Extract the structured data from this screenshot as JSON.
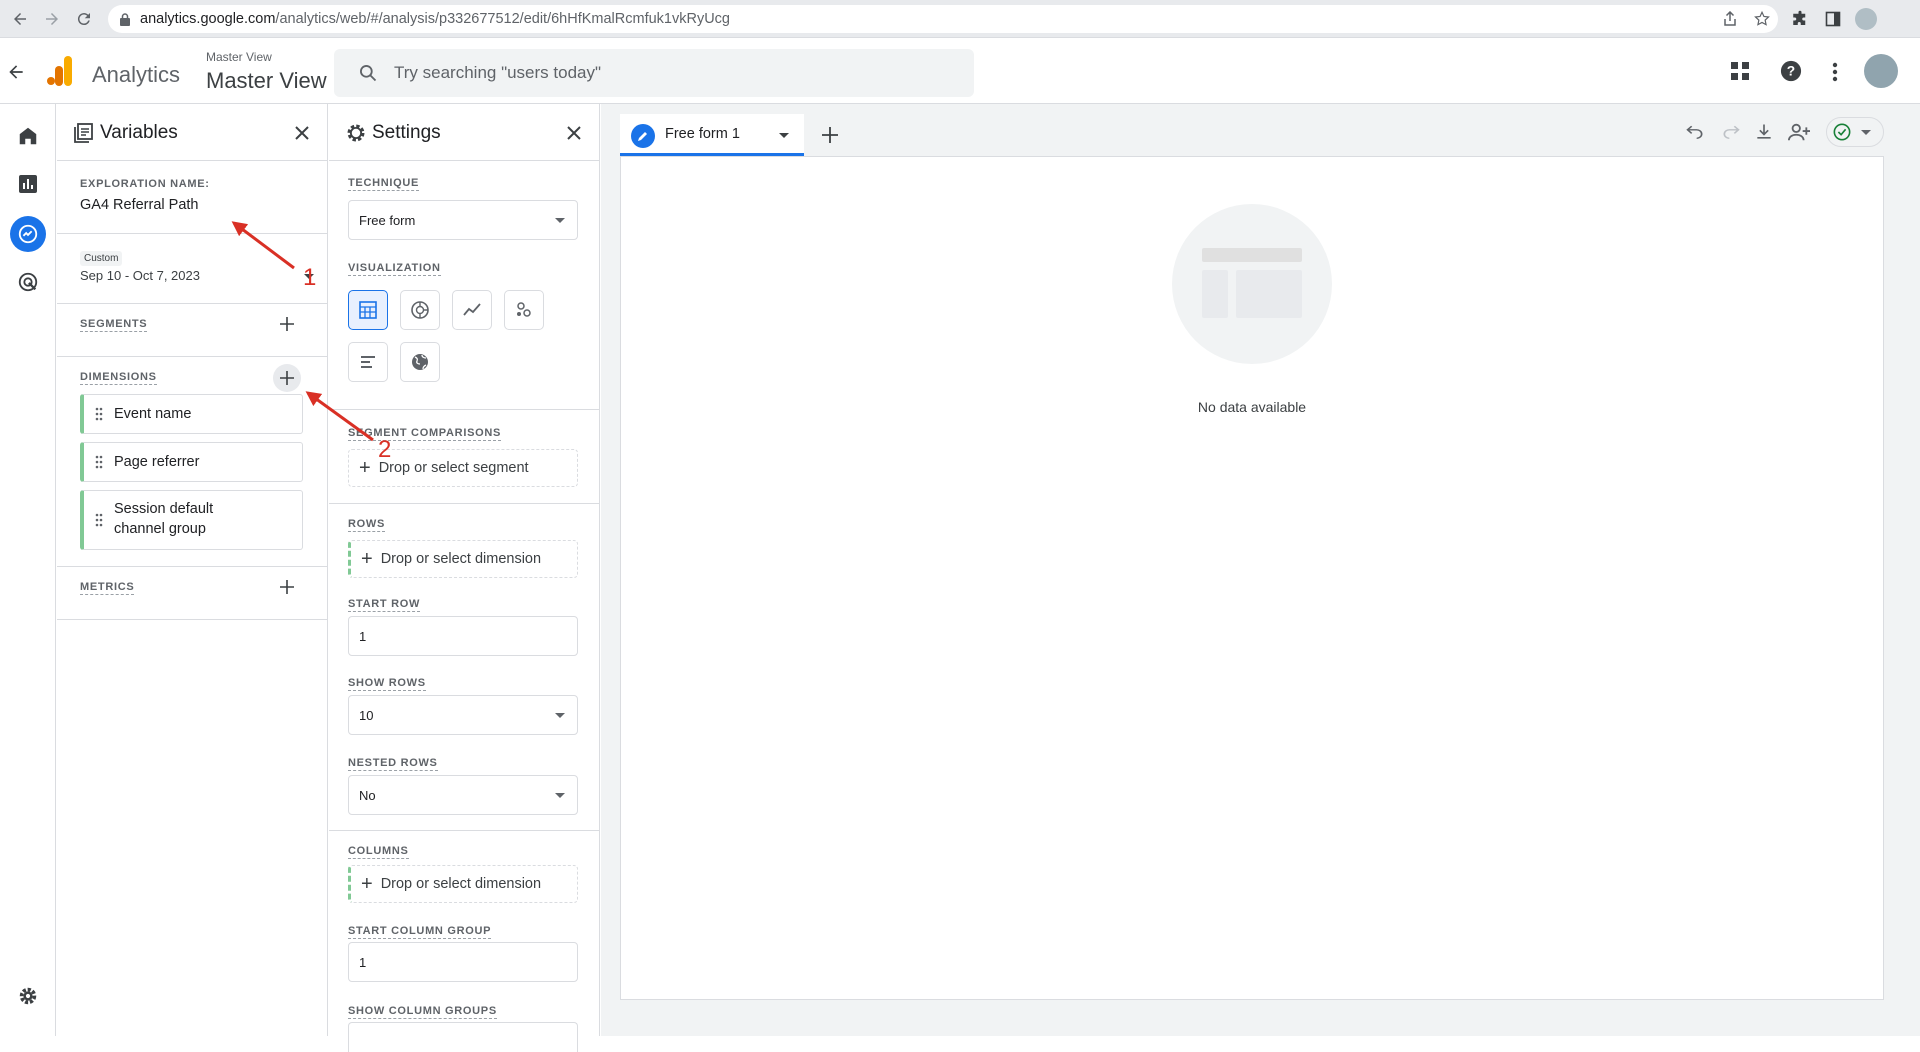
{
  "browser": {
    "url_domain": "analytics.google.com",
    "url_path": "/analytics/web/#/analysis/p332677512/edit/6hHfKmalRcmfuk1vkRyUcg"
  },
  "header": {
    "app_name": "Analytics",
    "account_label": "Master View",
    "property_name": "Master View",
    "search_placeholder": "Try searching \"users today\""
  },
  "variables_panel": {
    "title": "Variables",
    "exploration_label": "EXPLORATION NAME:",
    "exploration_name": "GA4 Referral Path",
    "date_badge": "Custom",
    "date_range": "Sep 10 - Oct 7, 2023",
    "segments_label": "SEGMENTS",
    "dimensions_label": "DIMENSIONS",
    "dimensions": [
      {
        "label": "Event name"
      },
      {
        "label": "Page referrer"
      },
      {
        "label": "Session default channel group"
      }
    ],
    "metrics_label": "METRICS"
  },
  "settings_panel": {
    "title": "Settings",
    "technique_label": "TECHNIQUE",
    "technique_value": "Free form",
    "visualization_label": "VISUALIZATION",
    "segment_comparisons_label": "SEGMENT COMPARISONS",
    "segment_drop": "Drop or select segment",
    "rows_label": "ROWS",
    "rows_drop": "Drop or select dimension",
    "start_row_label": "START ROW",
    "start_row_value": "1",
    "show_rows_label": "SHOW ROWS",
    "show_rows_value": "10",
    "nested_rows_label": "NESTED ROWS",
    "nested_rows_value": "No",
    "columns_label": "COLUMNS",
    "columns_drop": "Drop or select dimension",
    "start_column_group_label": "START COLUMN GROUP",
    "start_column_group_value": "1",
    "show_column_groups_label": "SHOW COLUMN GROUPS"
  },
  "canvas": {
    "tab_label": "Free form 1",
    "empty_message": "No data available"
  },
  "annotations": {
    "marker_1": "1",
    "marker_2": "2"
  },
  "colors": {
    "accent": "#1a73e8",
    "dimension_bar": "#81c995",
    "annotation": "#d93025",
    "logo_orange": "#f9ab00",
    "logo_dark_orange": "#e37400"
  }
}
